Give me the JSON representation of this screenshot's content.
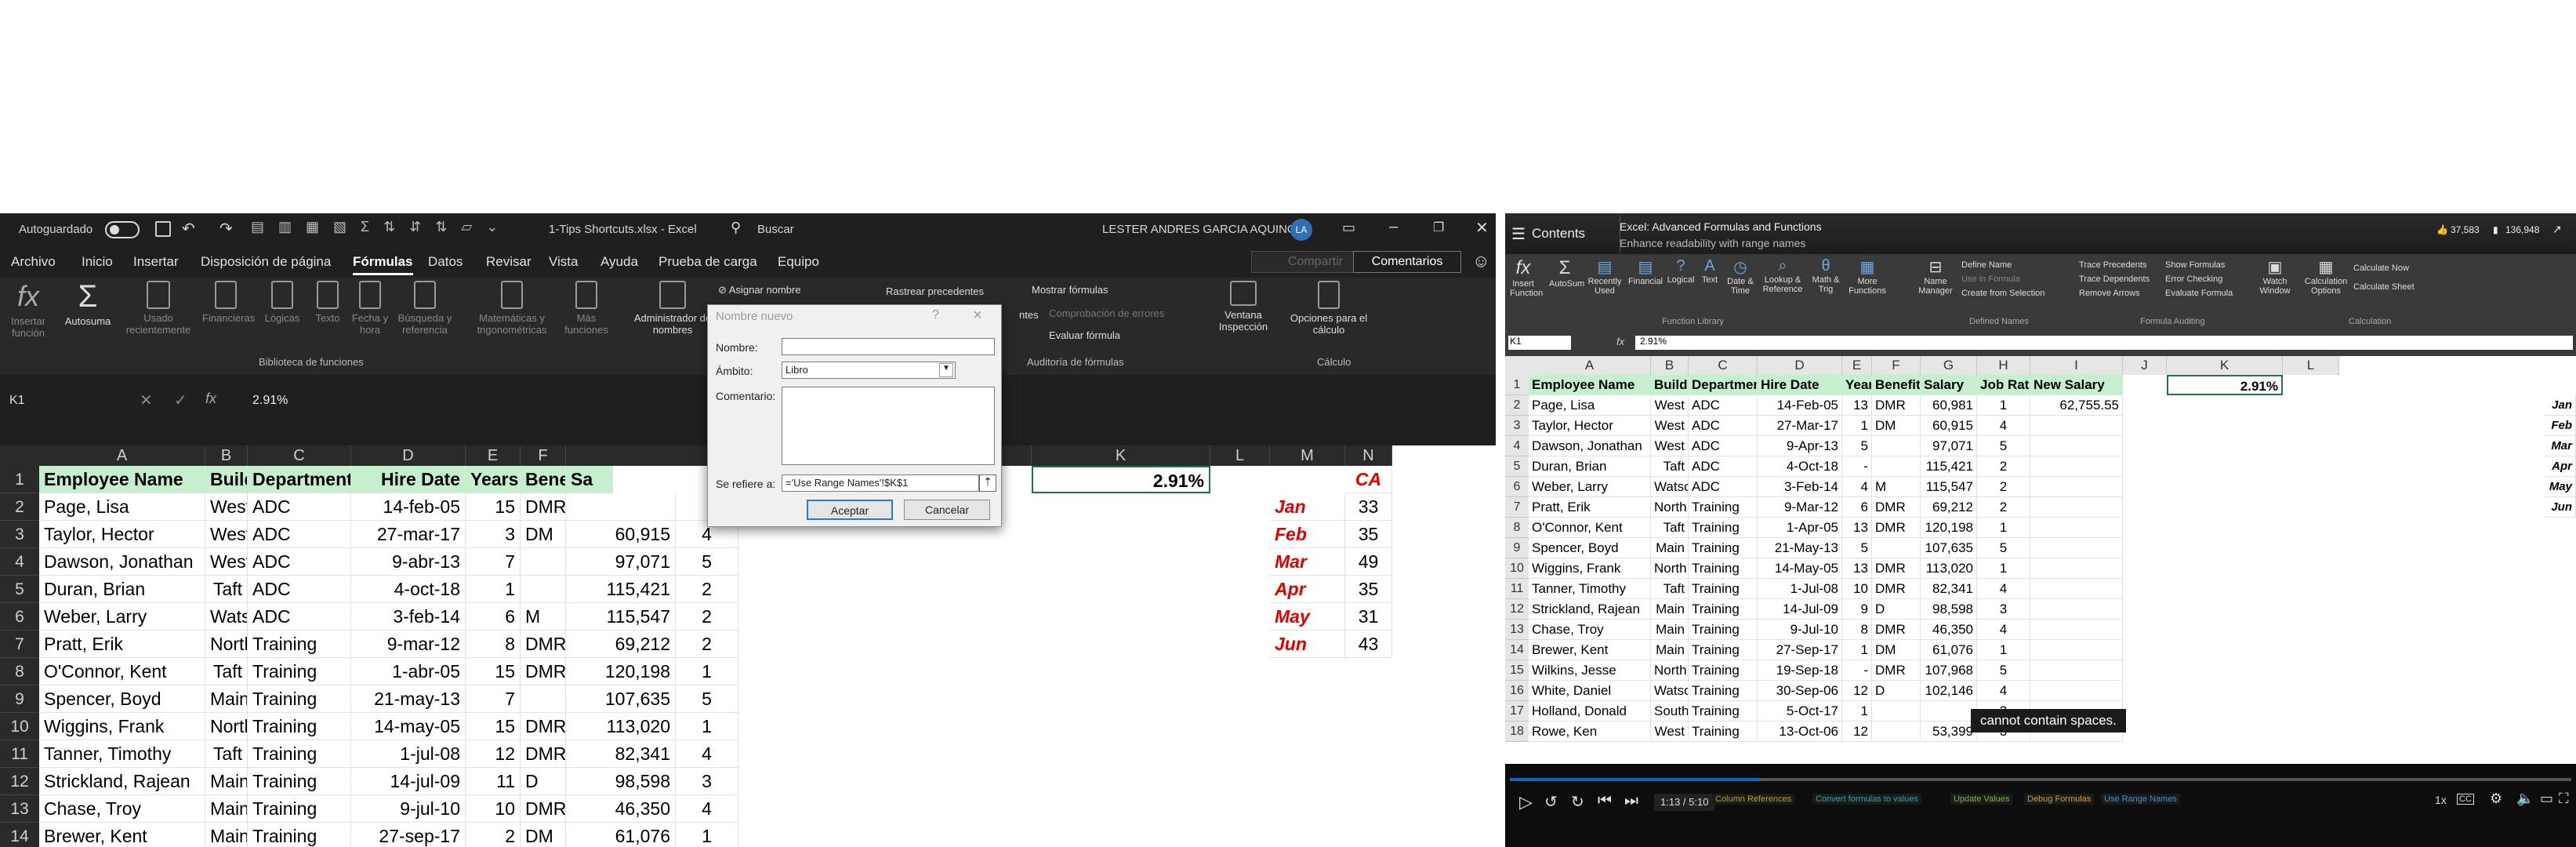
{
  "left_excel": {
    "autosave_label": "Autoguardado",
    "filename": "1-Tips Shortcuts.xlsx  -  Excel",
    "search_label": "Buscar",
    "user_name": "LESTER ANDRES GARCIA AQUINO",
    "user_initials": "LA",
    "menu": [
      "Archivo",
      "Inicio",
      "Insertar",
      "Disposición de página",
      "Fórmulas",
      "Datos",
      "Revisar",
      "Vista",
      "Ayuda",
      "Prueba de carga",
      "Equipo"
    ],
    "share_label": "Compartir",
    "comments_label": "Comentarios",
    "ribbon": {
      "insert_function": "Insertar función",
      "autosum": "Autosuma",
      "recent": "Usado recientemente",
      "financial": "Financieras",
      "logical": "Lógicas",
      "text": "Texto",
      "datetime": "Fecha y hora",
      "lookup": "Búsqueda y referencia",
      "math": "Matemáticas y trigonométricas",
      "more": "Más funciones",
      "library_group": "Biblioteca de funciones",
      "name_manager": "Administrador de nombres",
      "assign_name": "Asignar nombre",
      "trace_precedents": "Rastrear precedentes",
      "show_formulas": "Mostrar fórmulas",
      "error_check": "Comprobación de errores",
      "eval_formula": "Evaluar fórmula",
      "dependents_partial": "ntes",
      "audit_group": "Auditoría de fórmulas",
      "watch_window": "Ventana Inspección",
      "calc_options": "Opciones para el cálculo",
      "calc_group": "Cálculo"
    },
    "namebox": "K1",
    "formula": "2.91%",
    "columns": [
      "A",
      "B",
      "C",
      "D",
      "E",
      "F",
      "",
      "",
      "",
      "",
      "J",
      "K",
      "L",
      "M",
      "N"
    ],
    "headers": [
      "Employee Name",
      "Building",
      "Department",
      "Hire Date",
      "Years",
      "Benefits",
      "Sa"
    ],
    "rows": [
      [
        "Page, Lisa",
        "West",
        "ADC",
        "14-feb-05",
        "15",
        "DMR",
        "",
        "",
        ""
      ],
      [
        "Taylor, Hector",
        "West",
        "ADC",
        "27-mar-17",
        "3",
        "DM",
        "60,915",
        "4",
        ""
      ],
      [
        "Dawson, Jonathan",
        "West",
        "ADC",
        "9-abr-13",
        "7",
        "",
        "97,071",
        "5",
        ""
      ],
      [
        "Duran, Brian",
        "Taft",
        "ADC",
        "4-oct-18",
        "1",
        "",
        "115,421",
        "2",
        ""
      ],
      [
        "Weber, Larry",
        "Watson",
        "ADC",
        "3-feb-14",
        "6",
        "M",
        "115,547",
        "2",
        ""
      ],
      [
        "Pratt, Erik",
        "North",
        "Training",
        "9-mar-12",
        "8",
        "DMR",
        "69,212",
        "2",
        ""
      ],
      [
        "O'Connor, Kent",
        "Taft",
        "Training",
        "1-abr-05",
        "15",
        "DMR",
        "120,198",
        "1",
        ""
      ],
      [
        "Spencer, Boyd",
        "Main",
        "Training",
        "21-may-13",
        "7",
        "",
        "107,635",
        "5",
        ""
      ],
      [
        "Wiggins, Frank",
        "North",
        "Training",
        "14-may-05",
        "15",
        "DMR",
        "113,020",
        "1",
        ""
      ],
      [
        "Tanner, Timothy",
        "Taft",
        "Training",
        "1-jul-08",
        "12",
        "DMR",
        "82,341",
        "4",
        ""
      ],
      [
        "Strickland, Rajean",
        "Main",
        "Training",
        "14-jul-09",
        "11",
        "D",
        "98,598",
        "3",
        ""
      ],
      [
        "Chase, Troy",
        "Main",
        "Training",
        "9-jul-10",
        "10",
        "DMR",
        "46,350",
        "4",
        ""
      ],
      [
        "Brewer, Kent",
        "Main",
        "Training",
        "27-sep-17",
        "2",
        "DM",
        "61,076",
        "1",
        ""
      ]
    ],
    "k1_value": "2.91%",
    "n1_value": "CA",
    "months": [
      "Jan",
      "Feb",
      "Mar",
      "Apr",
      "May",
      "Jun"
    ],
    "n_values": [
      "33",
      "35",
      "49",
      "35",
      "31",
      "43"
    ]
  },
  "dialog": {
    "title": "Nombre nuevo",
    "help": "?",
    "close": "×",
    "name_label": "Nombre:",
    "scope_label": "Ámbito:",
    "scope_value": "Libro",
    "comment_label": "Comentario:",
    "refers_label": "Se refiere a:",
    "refers_value": "='Use Range Names'!$K$1",
    "ok": "Aceptar",
    "cancel": "Cancelar"
  },
  "right_video": {
    "contents_label": "Contents",
    "course_title": "Excel: Advanced Formulas and Functions",
    "lesson_title": "Enhance readability with range names",
    "likes": "37,583",
    "saves": "136,948",
    "ribbon": {
      "insert_function": "Insert Function",
      "autosum": "AutoSum",
      "recent": "Recently Used",
      "financial": "Financial",
      "logical": "Logical",
      "text": "Text",
      "datetime": "Date & Time",
      "lookup": "Lookup & Reference",
      "math": "Math & Trig",
      "more": "More Functions",
      "library_group": "Function Library",
      "name_manager": "Name Manager",
      "define_name": "Define Name",
      "use_in_formula": "Use in Formula",
      "create_from_selection": "Create from Selection",
      "defined_group": "Defined Names",
      "trace_precedents": "Trace Precedents",
      "trace_dependents": "Trace Dependents",
      "remove_arrows": "Remove Arrows",
      "show_formulas": "Show Formulas",
      "error_checking": "Error Checking",
      "evaluate_formula": "Evaluate Formula",
      "watch_window": "Watch Window",
      "audit_group": "Formula Auditing",
      "calc_options": "Calculation Options",
      "calc_now": "Calculate Now",
      "calc_sheet": "Calculate Sheet",
      "calc_group": "Calculation"
    },
    "namebox": "K1",
    "formula": "2.91%",
    "columns": [
      "A",
      "B",
      "C",
      "D",
      "E",
      "F",
      "G",
      "H",
      "I",
      "J",
      "K",
      "L"
    ],
    "headers": [
      "Employee Name",
      "Building",
      "Department",
      "Hire Date",
      "Years",
      "Benefits",
      "Salary",
      "Job Rating",
      "New Salary",
      "",
      "2.91%"
    ],
    "rows": [
      [
        "Page, Lisa",
        "West",
        "ADC",
        "14-Feb-05",
        "13",
        "DMR",
        "60,981",
        "1",
        "62,755.55"
      ],
      [
        "Taylor, Hector",
        "West",
        "ADC",
        "27-Mar-17",
        "1",
        "DM",
        "60,915",
        "4",
        ""
      ],
      [
        "Dawson, Jonathan",
        "West",
        "ADC",
        "9-Apr-13",
        "5",
        "",
        "97,071",
        "5",
        ""
      ],
      [
        "Duran, Brian",
        "Taft",
        "ADC",
        "4-Oct-18",
        "-",
        "",
        "115,421",
        "2",
        ""
      ],
      [
        "Weber, Larry",
        "Watson",
        "ADC",
        "3-Feb-14",
        "4",
        "M",
        "115,547",
        "2",
        ""
      ],
      [
        "Pratt, Erik",
        "North",
        "Training",
        "9-Mar-12",
        "6",
        "DMR",
        "69,212",
        "2",
        ""
      ],
      [
        "O'Connor, Kent",
        "Taft",
        "Training",
        "1-Apr-05",
        "13",
        "DMR",
        "120,198",
        "1",
        ""
      ],
      [
        "Spencer, Boyd",
        "Main",
        "Training",
        "21-May-13",
        "5",
        "",
        "107,635",
        "5",
        ""
      ],
      [
        "Wiggins, Frank",
        "North",
        "Training",
        "14-May-05",
        "13",
        "DMR",
        "113,020",
        "1",
        ""
      ],
      [
        "Tanner, Timothy",
        "Taft",
        "Training",
        "1-Jul-08",
        "10",
        "DMR",
        "82,341",
        "4",
        ""
      ],
      [
        "Strickland, Rajean",
        "Main",
        "Training",
        "14-Jul-09",
        "9",
        "D",
        "98,598",
        "3",
        ""
      ],
      [
        "Chase, Troy",
        "Main",
        "Training",
        "9-Jul-10",
        "8",
        "DMR",
        "46,350",
        "4",
        ""
      ],
      [
        "Brewer, Kent",
        "Main",
        "Training",
        "27-Sep-17",
        "1",
        "DM",
        "61,076",
        "1",
        ""
      ],
      [
        "Wilkins, Jesse",
        "North",
        "Training",
        "19-Sep-18",
        "-",
        "DMR",
        "107,968",
        "5",
        ""
      ],
      [
        "White, Daniel",
        "Watson",
        "Training",
        "30-Sep-06",
        "12",
        "D",
        "102,146",
        "4",
        ""
      ],
      [
        "Holland, Donald",
        "South",
        "Training",
        "5-Oct-17",
        "1",
        "",
        "",
        "3",
        ""
      ],
      [
        "Rowe, Ken",
        "West",
        "Training",
        "13-Oct-06",
        "12",
        "",
        "53,399",
        "3",
        ""
      ]
    ],
    "months": [
      "Jan",
      "Feb",
      "Mar",
      "Apr",
      "May",
      "Jun"
    ],
    "caption": "cannot contain spaces.",
    "time": "1:13 / 5:10",
    "chapters": [
      "Column References",
      "Convert formulas to values",
      "Update Values",
      "Debug Formulas",
      "Use Range Names"
    ],
    "speed": "1x",
    "cc": "CC"
  }
}
